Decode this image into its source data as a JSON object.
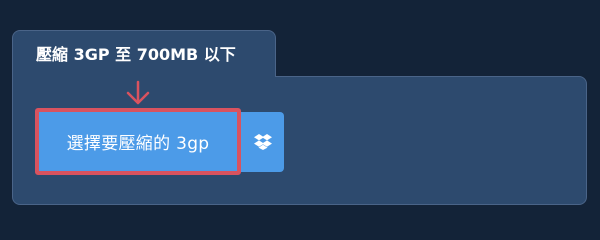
{
  "panel": {
    "title": "壓縮 3GP 至 700MB 以下"
  },
  "upload": {
    "choose_label": "選擇要壓縮的 3gp",
    "dropbox_icon": "dropbox-icon",
    "arrow_icon": "arrow-down-icon"
  },
  "colors": {
    "background": "#132338",
    "panel": "#2d4a6e",
    "button": "#4c9be8",
    "highlight": "#d9535f"
  }
}
